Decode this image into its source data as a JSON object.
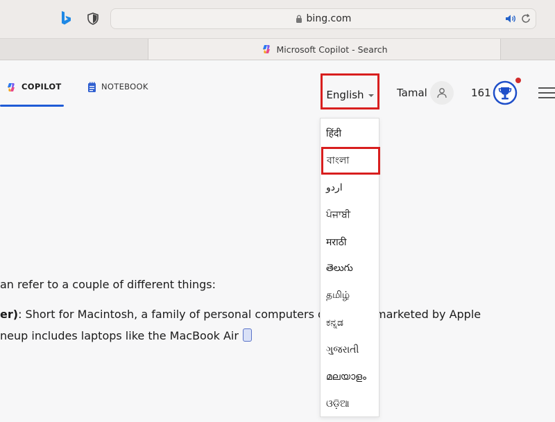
{
  "browser": {
    "address": "bing.com",
    "tab_title": "Microsoft Copilot - Search"
  },
  "header": {
    "nav": [
      {
        "label": "COPILOT",
        "active": true
      },
      {
        "label": "NOTEBOOK",
        "active": false
      }
    ],
    "language_button": "English",
    "user_name": "Tamal",
    "points": "161"
  },
  "languages": [
    "हिंदी",
    "বাংলা",
    "اردو",
    "ਪੰਜਾਬੀ",
    "मराठी",
    "తెలుగు",
    "தமிழ்",
    "ಕನ್ನಡ",
    "ગુજરાતી",
    "മലയാളം",
    "ଓଡ଼ିଆ"
  ],
  "content": {
    "line1": "an refer to a couple of different things:",
    "line2_bold": "er)",
    "line2_rest": ": Short for Macintosh, a family of personal computers desi",
    "line2_tail": "marketed by Apple",
    "line3": "neup includes laptops like the MacBook Air"
  },
  "colors": {
    "highlight": "#d81e1e",
    "accent": "#1f5bd6"
  }
}
